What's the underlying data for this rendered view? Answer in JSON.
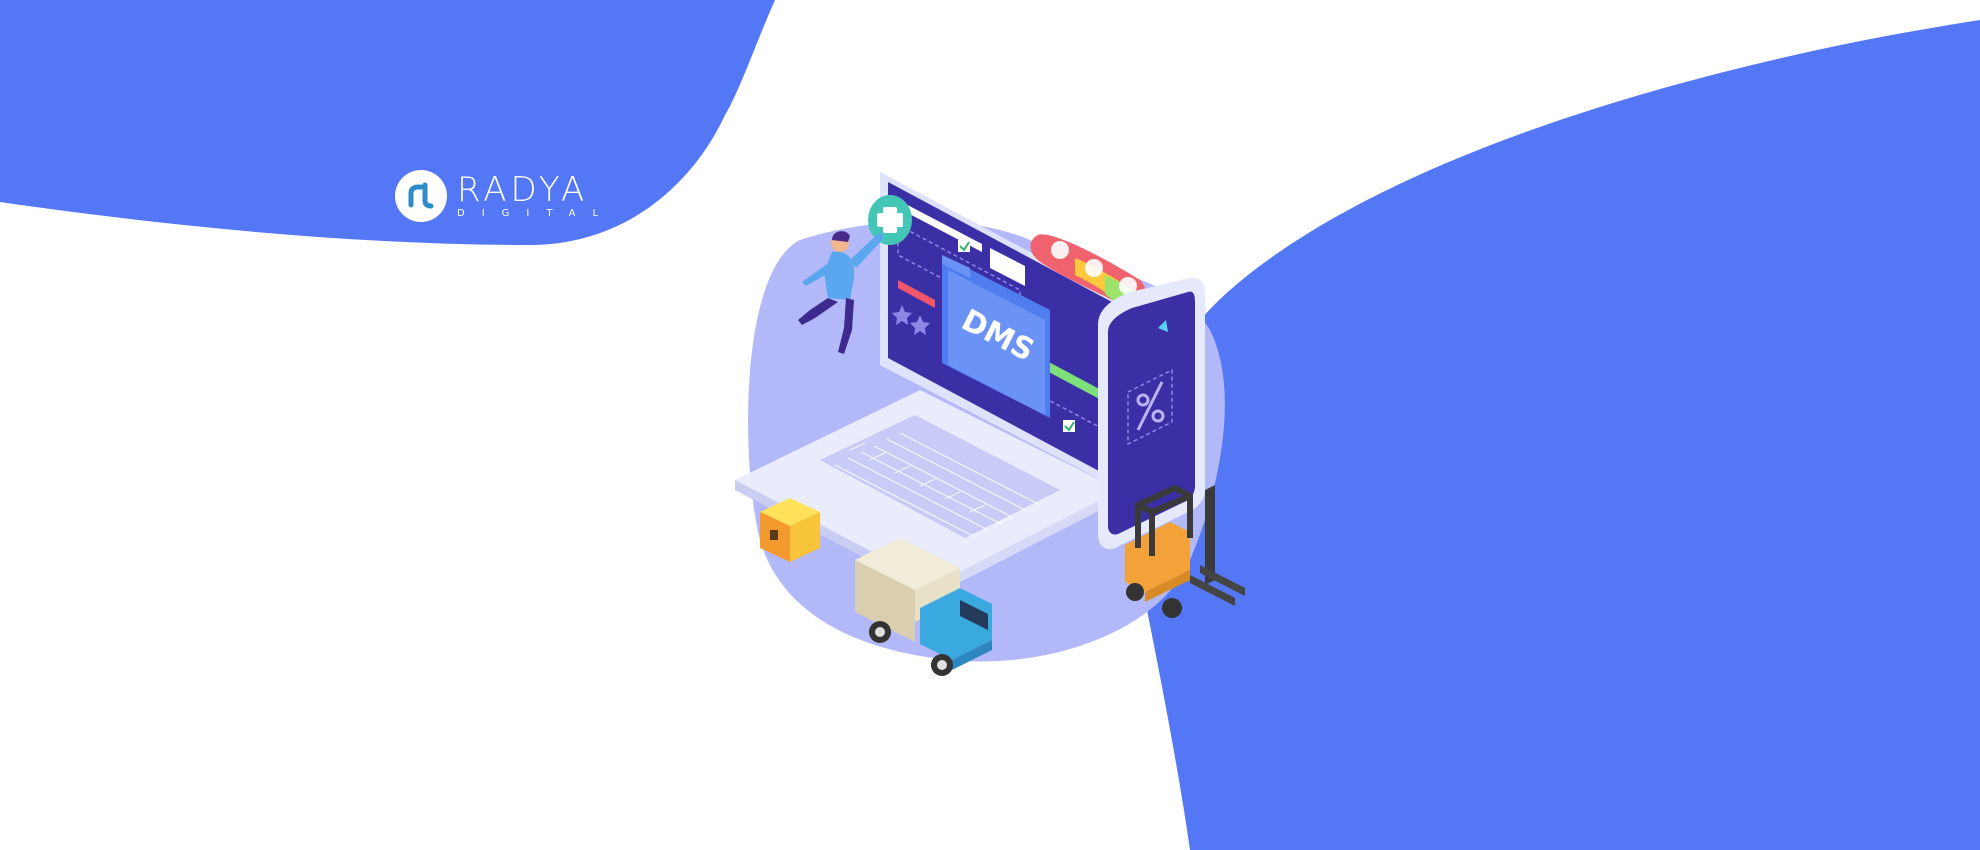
{
  "brand": {
    "name": "RADYA",
    "tagline": "DIGITAL",
    "logo_icon": "rl-monogram-icon"
  },
  "illustration": {
    "label": "DMS",
    "icons": [
      "plus-icon",
      "sad-face-icon",
      "neutral-face-icon",
      "happy-face-icon",
      "percent-icon",
      "star-icon",
      "check-icon"
    ]
  },
  "colors": {
    "background": "#ffffff",
    "brand_blue": "#5478f5",
    "blob_lavender": "#b2b8f8",
    "screen_dark": "#3b2fa6",
    "folder_blue": "#4f7df0"
  }
}
